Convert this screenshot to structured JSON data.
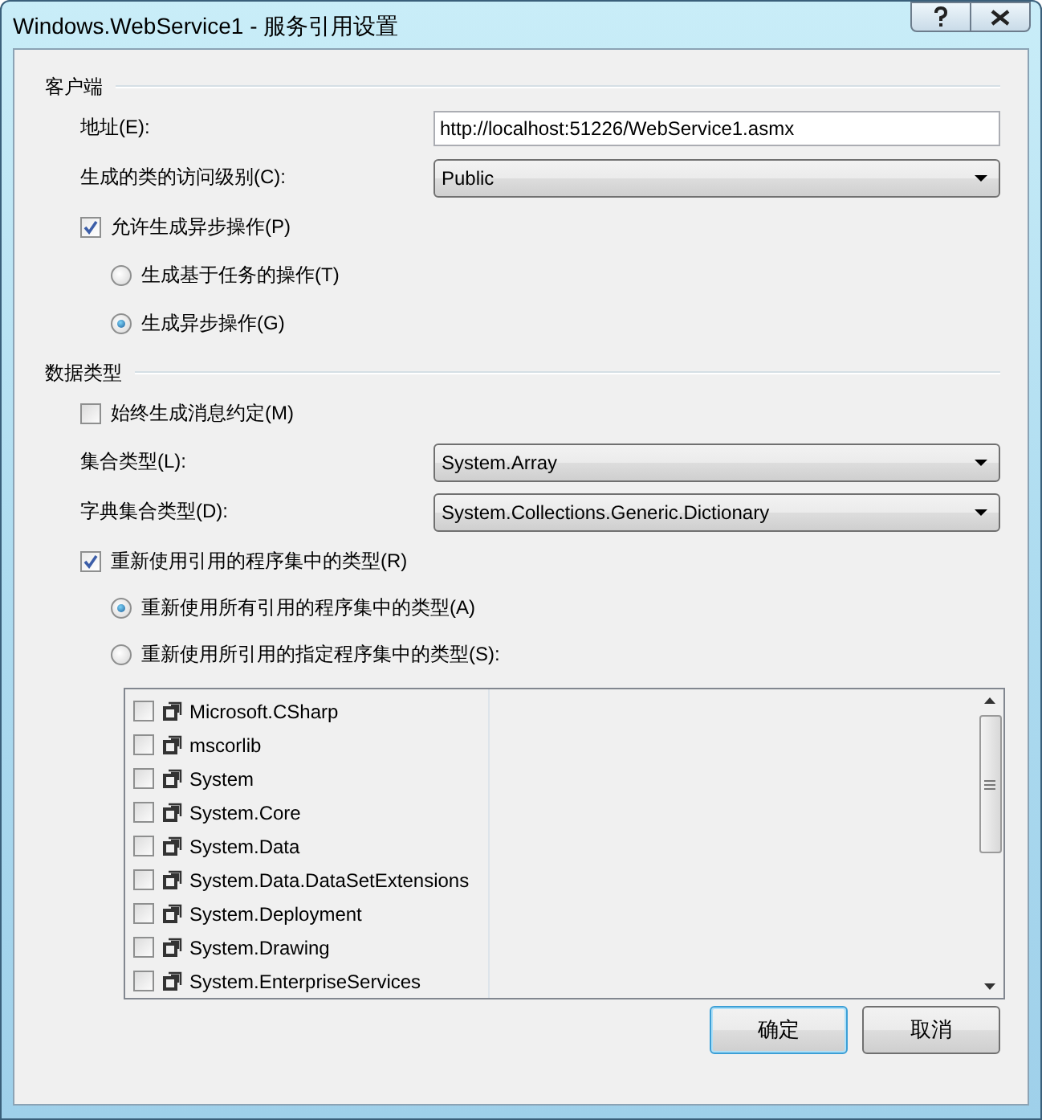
{
  "window": {
    "title": "Windows.WebService1 - 服务引用设置"
  },
  "client": {
    "heading": "客户端",
    "address": {
      "label": "地址(E):",
      "value": "http://localhost:51226/WebService1.asmx"
    },
    "access_level": {
      "label": "生成的类的访问级别(C):",
      "value": "Public"
    },
    "async_ops": {
      "label": "允许生成异步操作(P)",
      "checked": true
    },
    "async_mode": [
      {
        "label": "生成基于任务的操作(T)",
        "selected": false
      },
      {
        "label": "生成异步操作(G)",
        "selected": true
      }
    ]
  },
  "data_types": {
    "heading": "数据类型",
    "always_contracts": {
      "label": "始终生成消息约定(M)",
      "checked": false
    },
    "collection_type": {
      "label": "集合类型(L):",
      "value": "System.Array"
    },
    "dictionary_type": {
      "label": "字典集合类型(D):",
      "value": "System.Collections.Generic.Dictionary"
    },
    "reuse_types": {
      "label": "重新使用引用的程序集中的类型(R)",
      "checked": true
    },
    "reuse_mode": [
      {
        "label": "重新使用所有引用的程序集中的类型(A)",
        "selected": true
      },
      {
        "label": "重新使用所引用的指定程序集中的类型(S):",
        "selected": false
      }
    ],
    "assemblies": [
      {
        "name": "Microsoft.CSharp",
        "checked": false
      },
      {
        "name": "mscorlib",
        "checked": false
      },
      {
        "name": "System",
        "checked": false
      },
      {
        "name": "System.Core",
        "checked": false
      },
      {
        "name": "System.Data",
        "checked": false
      },
      {
        "name": "System.Data.DataSetExtensions",
        "checked": false
      },
      {
        "name": "System.Deployment",
        "checked": false
      },
      {
        "name": "System.Drawing",
        "checked": false
      },
      {
        "name": "System.EnterpriseServices",
        "checked": false
      }
    ]
  },
  "buttons": [
    "确定",
    "取消"
  ]
}
